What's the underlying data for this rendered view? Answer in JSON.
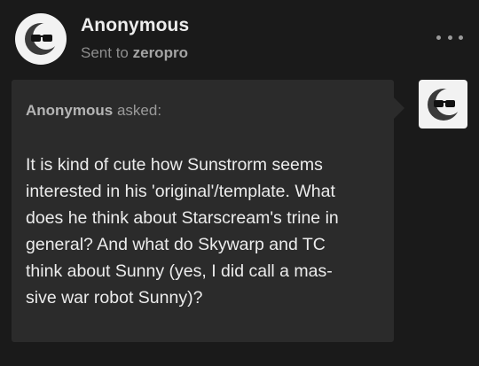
{
  "post": {
    "sender_name": "Anonymous",
    "sent_to_prefix": "Sent to",
    "recipient": "zeropro",
    "avatar_icon": "anonymous-sunglasses-icon",
    "more_icon": "more-options-icon"
  },
  "ask": {
    "asker_name": "Anonymous",
    "asked_label": "asked:",
    "question_lines": [
      "It is kind of cute how Sunstrorm seems",
      "interested in his 'original'/template. What",
      "does he think about Starscream's trine in",
      "general? And what do Skywarp and TC",
      "think about Sunny (yes, I did call a mas-",
      "sive war robot Sunny)?"
    ]
  },
  "colors": {
    "background": "#1a1a1a",
    "bubble": "#2b2b2b",
    "primary_text": "#ececec",
    "secondary_text": "#9a9a9a"
  }
}
